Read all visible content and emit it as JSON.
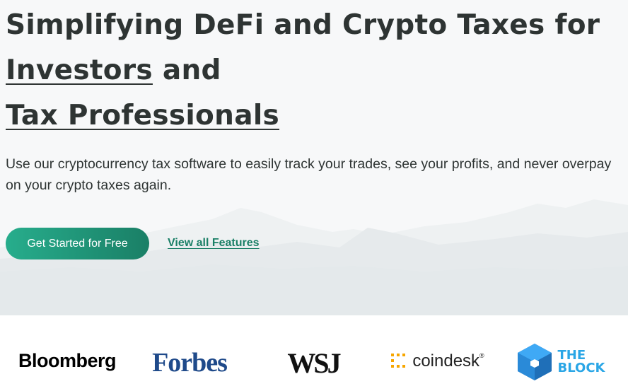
{
  "hero": {
    "title_line1": "Simplifying DeFi and Crypto Taxes for",
    "title_link1": "Investors",
    "title_and": " and",
    "title_link2": "Tax Professionals",
    "subtitle": "Use our cryptocurrency tax software to easily track your trades, see your profits, and never overpay on your crypto taxes again.",
    "cta_label": "Get Started for Free",
    "features_link": "View all Features"
  },
  "press": {
    "logos": [
      {
        "name": "Bloomberg",
        "text": "Bloomberg"
      },
      {
        "name": "Forbes",
        "text": "Forbes"
      },
      {
        "name": "WSJ",
        "text": "WSJ"
      },
      {
        "name": "CoinDesk",
        "text": "coindesk"
      },
      {
        "name": "The Block",
        "text_line1": "THE",
        "text_line2": "BLOCK"
      }
    ]
  },
  "colors": {
    "accent": "#1a7f66",
    "accent_light": "#27ad8c",
    "text": "#2e3433",
    "coindesk_gold": "#f7a600",
    "block_blue": "#1f6fb8"
  }
}
